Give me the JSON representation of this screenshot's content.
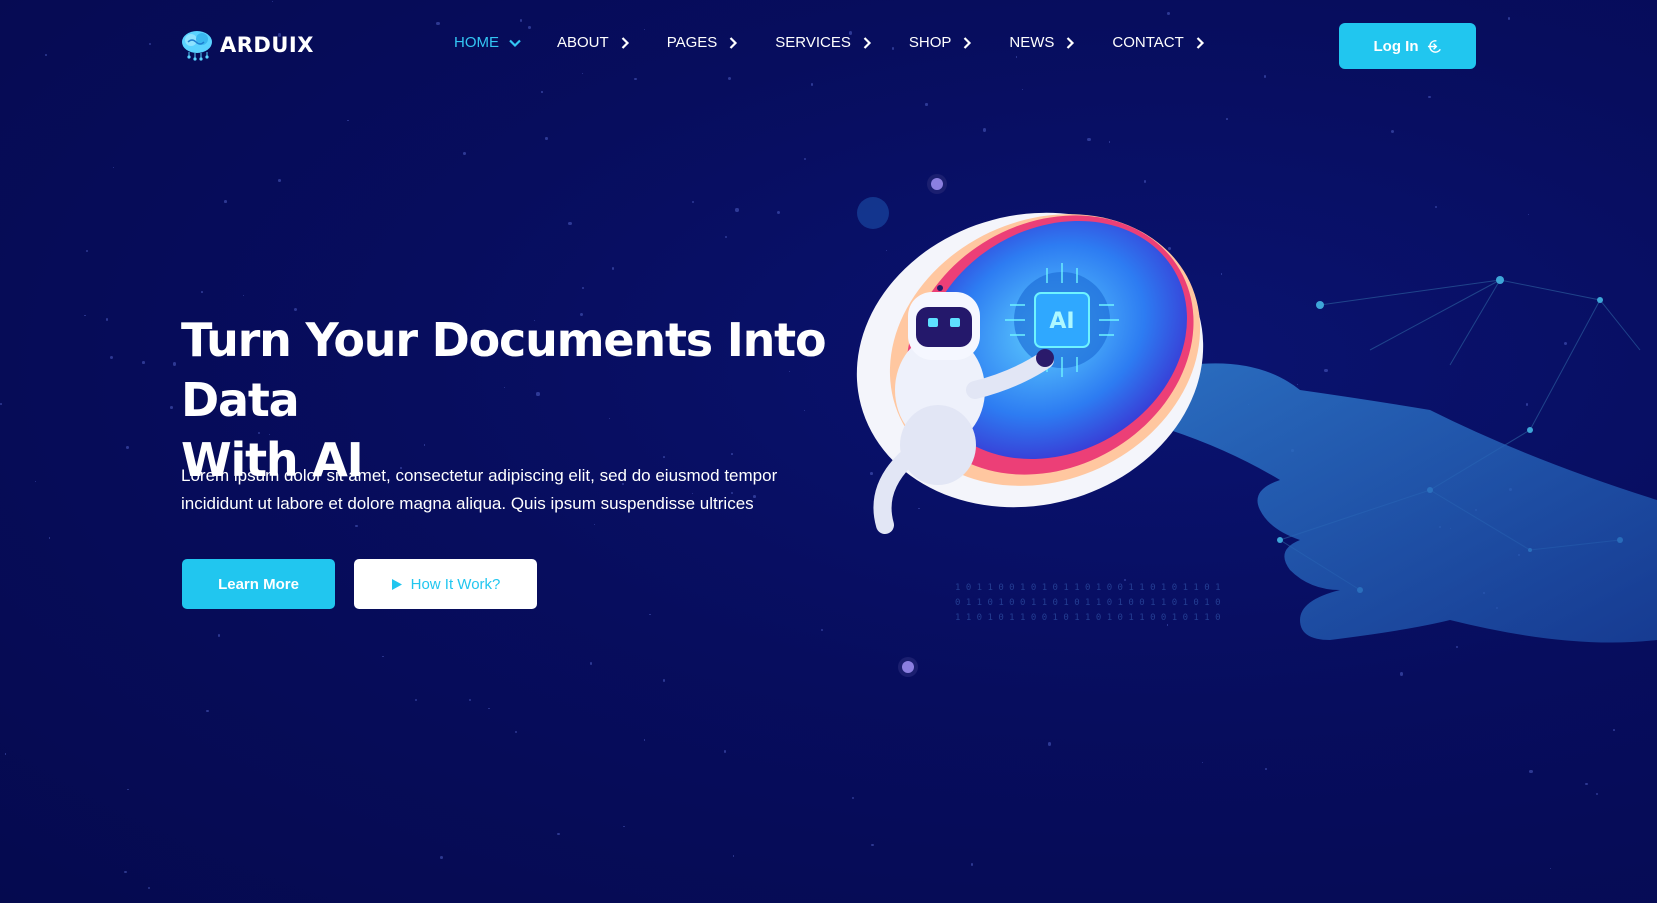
{
  "brand": {
    "name": "ARDUIX",
    "logo_icon": "brain-icon"
  },
  "nav": {
    "items": [
      {
        "label": "HOME",
        "active": true,
        "icon": "chevron-down-icon"
      },
      {
        "label": "ABOUT",
        "active": false,
        "icon": "chevron-right-icon"
      },
      {
        "label": "PAGES",
        "active": false,
        "icon": "chevron-right-icon"
      },
      {
        "label": "SERVICES",
        "active": false,
        "icon": "chevron-right-icon"
      },
      {
        "label": "SHOP",
        "active": false,
        "icon": "chevron-right-icon"
      },
      {
        "label": "NEWS",
        "active": false,
        "icon": "chevron-right-icon"
      },
      {
        "label": "CONTACT",
        "active": false,
        "icon": "chevron-right-icon"
      }
    ],
    "login_label": "Log In",
    "login_icon": "sign-in-icon"
  },
  "hero": {
    "title_line1": "Turn Your Documents Into Data",
    "title_line2": "With AI",
    "text": "Lorem ipsum dolor sit amet, consectetur adipiscing elit, sed do eiusmod tempor incididunt ut labore et dolore magna aliqua. Quis ipsum suspendisse ultrices",
    "learn_more_label": "Learn More",
    "how_it_works_label": "How It Work?",
    "play_icon": "play-icon",
    "chip_label": "AI"
  },
  "colors": {
    "background": "#070d5e",
    "accent": "#21c6ef",
    "active_nav": "#33c6f4"
  }
}
